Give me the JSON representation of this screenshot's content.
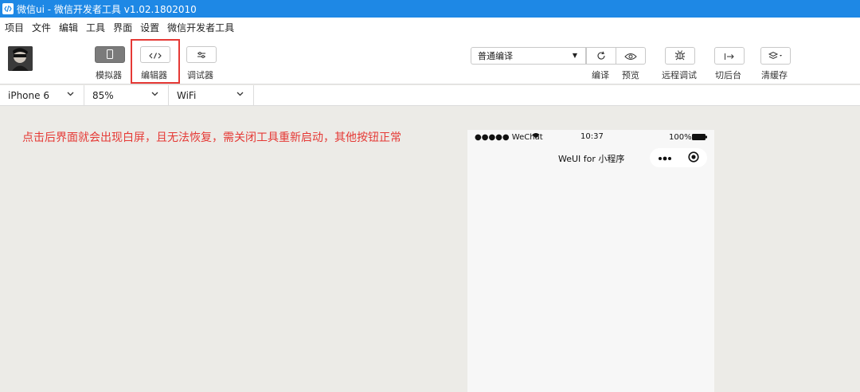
{
  "window": {
    "title": "微信ui - 微信开发者工具 v1.02.1802010"
  },
  "menu": [
    "项目",
    "文件",
    "编辑",
    "工具",
    "界面",
    "设置",
    "微信开发者工具"
  ],
  "toolbar": {
    "simulator_label": "模拟器",
    "editor_label": "编辑器",
    "debugger_label": "调试器",
    "compile_mode": "普通编译",
    "compile_label": "编译",
    "preview_label": "预览",
    "remote_debug_label": "远程调试",
    "background_label": "切后台",
    "clear_cache_label": "清缓存"
  },
  "device_bar": {
    "device": "iPhone 6",
    "zoom": "85%",
    "network": "WiFi"
  },
  "annotation": {
    "text": "点击后界面就会出现白屏，且无法恢复，需关闭工具重新启动，其他按钮正常",
    "color": "#e53935"
  },
  "phone": {
    "status_carrier": "●●●●● WeChat",
    "status_time": "10:37",
    "status_battery": "100%",
    "nav_title": "WeUI for 小程序"
  },
  "colors": {
    "titlebar": "#1e88e5",
    "highlight": "#e53935"
  }
}
